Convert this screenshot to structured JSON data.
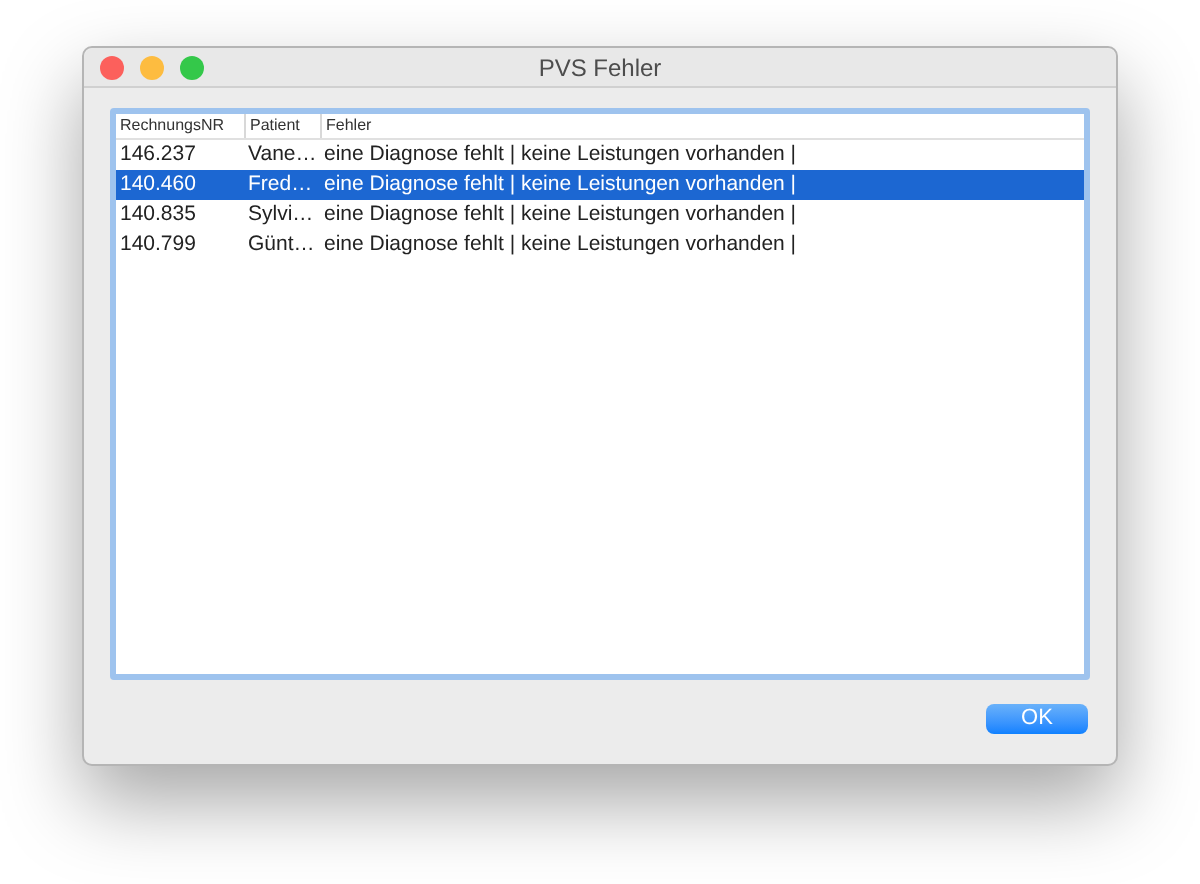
{
  "window": {
    "title": "PVS Fehler"
  },
  "table": {
    "columns": [
      "RechnungsNR",
      "Patient",
      "Fehler"
    ],
    "rows": [
      {
        "cells": [
          "146.237",
          "Vane…",
          "eine Diagnose fehlt | keine Leistungen vorhanden |"
        ],
        "selected": false
      },
      {
        "cells": [
          "140.460",
          "Fred…",
          "eine Diagnose fehlt | keine Leistungen vorhanden |"
        ],
        "selected": true
      },
      {
        "cells": [
          "140.835",
          "Sylvi…",
          "eine Diagnose fehlt | keine Leistungen vorhanden |"
        ],
        "selected": false
      },
      {
        "cells": [
          "140.799",
          "Günt…",
          "eine Diagnose fehlt | keine Leistungen vorhanden |"
        ],
        "selected": false
      }
    ]
  },
  "buttons": [
    "OK"
  ]
}
